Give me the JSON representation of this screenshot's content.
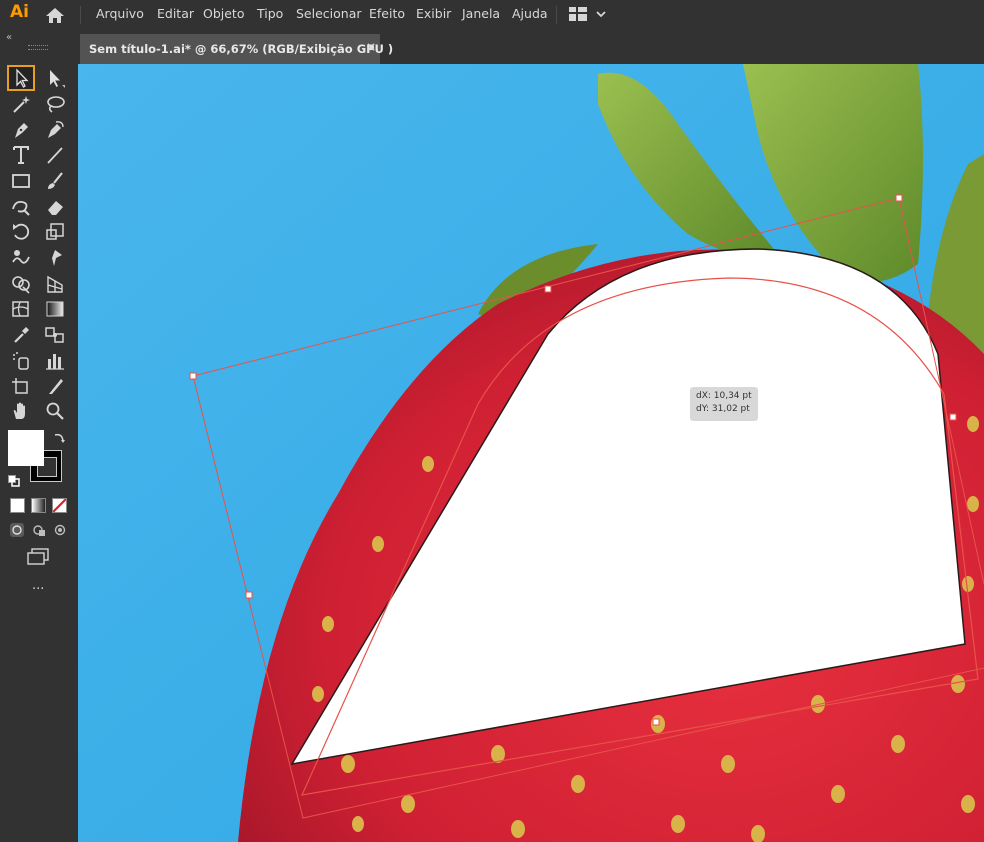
{
  "app": {
    "logo": "Ai"
  },
  "menu": [
    "Arquivo",
    "Editar",
    "Objeto",
    "Tipo",
    "Selecionar",
    "Efeito",
    "Exibir",
    "Janela",
    "Ajuda"
  ],
  "document_tab": {
    "title": "Sem título-1.ai* @ 66,67% (RGB/Exibição GPU )",
    "close": "×"
  },
  "toolbar": {
    "collapse": "«",
    "more": "···",
    "tools": [
      "selection-tool",
      "direct-selection-tool",
      "magic-wand-tool",
      "lasso-tool",
      "pen-tool",
      "curvature-tool",
      "type-tool",
      "line-segment-tool",
      "rectangle-tool",
      "paintbrush-tool",
      "shaper-tool",
      "eraser-tool",
      "rotate-tool",
      "scale-tool",
      "warp-tool",
      "puppet-warp-tool",
      "shape-builder-tool",
      "perspective-grid-tool",
      "mesh-tool",
      "gradient-tool",
      "eyedropper-tool",
      "blend-tool",
      "symbol-sprayer-tool",
      "column-graph-tool",
      "artboard-tool",
      "slice-tool",
      "hand-tool",
      "zoom-tool"
    ],
    "fill_color": "#ffffff",
    "stroke_color": "#000000"
  },
  "canvas": {
    "tooltip": {
      "dx": "dX: 10,34 pt",
      "dy": "dY: 31,02 pt"
    },
    "colors": {
      "sky": "#3fb0e8",
      "strawberry": "#d8283a",
      "leaf": "#7ea33a",
      "selection": "#e8524a",
      "shape_fill": "#ffffff"
    }
  }
}
